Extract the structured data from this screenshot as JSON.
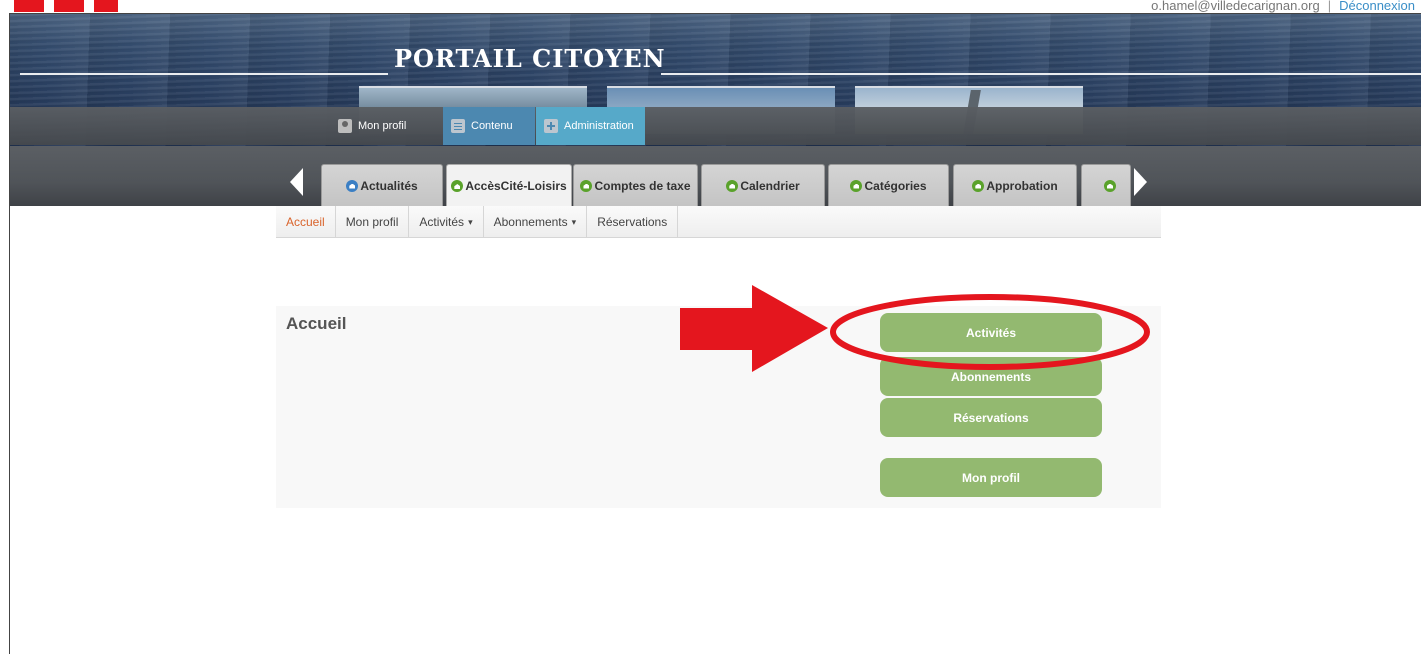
{
  "header": {
    "user_email": "o.hamel@villedecarignan.org",
    "separator": "|",
    "logout_label": "Déconnexion"
  },
  "banner": {
    "title": "PORTAIL CITOYEN"
  },
  "admin_bar": {
    "items": [
      {
        "label": "Mon profil",
        "icon": "profile-icon"
      },
      {
        "label": "Contenu",
        "icon": "content-icon"
      },
      {
        "label": "Administration",
        "icon": "admin-icon"
      }
    ]
  },
  "app_tabs": {
    "items": [
      {
        "label": "Actualités",
        "icon": "home-icon"
      },
      {
        "label": "AccèsCité-Loisirs",
        "icon": "home-icon",
        "active": true
      },
      {
        "label": "Comptes de taxe",
        "icon": "home-icon"
      },
      {
        "label": "Calendrier",
        "icon": "home-icon"
      },
      {
        "label": "Catégories",
        "icon": "home-icon"
      },
      {
        "label": "Approbation",
        "icon": "home-icon"
      }
    ]
  },
  "subnav": {
    "items": [
      {
        "label": "Accueil",
        "active": true
      },
      {
        "label": "Mon profil"
      },
      {
        "label": "Activités",
        "caret": "▾"
      },
      {
        "label": "Abonnements",
        "caret": "▾"
      },
      {
        "label": "Réservations"
      }
    ]
  },
  "main": {
    "title": "Accueil",
    "buttons": [
      {
        "label": "Activités"
      },
      {
        "label": "Abonnements"
      },
      {
        "label": "Réservations"
      },
      {
        "label": "Mon profil"
      }
    ]
  },
  "colors": {
    "button_green": "#93b970",
    "annotation_red": "#e4161e",
    "active_subnav": "#d9632b",
    "admin_active": "#4c88b0"
  }
}
